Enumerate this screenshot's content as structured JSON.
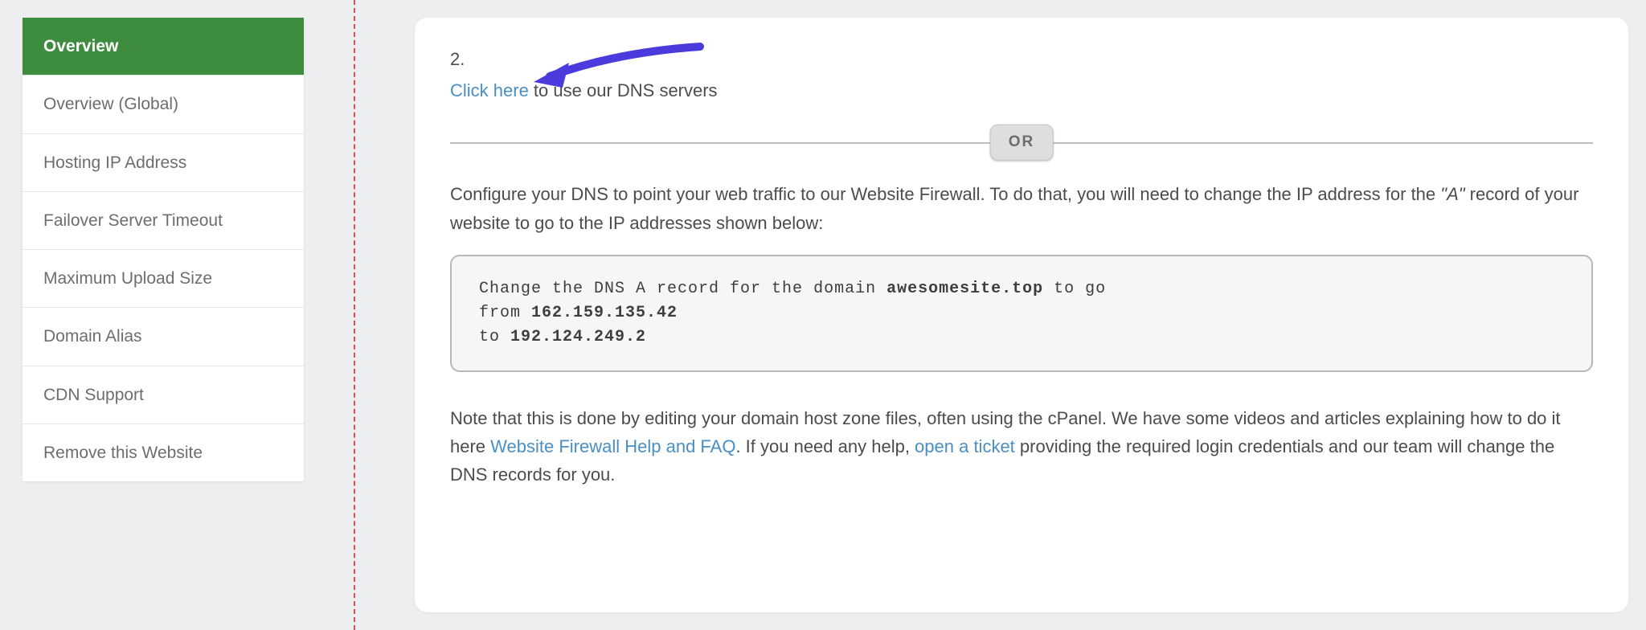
{
  "sidebar": {
    "items": [
      {
        "label": "Overview",
        "active": true
      },
      {
        "label": "Overview (Global)",
        "active": false
      },
      {
        "label": "Hosting IP Address",
        "active": false
      },
      {
        "label": "Failover Server Timeout",
        "active": false
      },
      {
        "label": "Maximum Upload Size",
        "active": false
      },
      {
        "label": "Domain Alias",
        "active": false
      },
      {
        "label": "CDN Support",
        "active": false
      },
      {
        "label": "Remove this Website",
        "active": false
      }
    ]
  },
  "main": {
    "step_number": "2.",
    "click_here_label": "Click here",
    "click_here_suffix": " to use our DNS servers",
    "or_label": "OR",
    "paragraph1_a": "Configure your DNS to point your web traffic to our Website Firewall. To do that, you will need to change the IP address for the ",
    "paragraph1_italic": "\"A\"",
    "paragraph1_b": " record of your website to go to the IP addresses shown below:",
    "code": {
      "line1_prefix": "Change the DNS A record for the domain ",
      "line1_domain": "awesomesite.top",
      "line1_suffix": " to go",
      "line2_prefix": "from ",
      "line2_ip": "162.159.135.42",
      "line3_prefix": "to ",
      "line3_ip": "192.124.249.2"
    },
    "paragraph2_a": "Note that this is done by editing your domain host zone files, often using the cPanel. We have some videos and articles explaining how to do it here ",
    "paragraph2_link1": "Website Firewall Help and FAQ",
    "paragraph2_b": ". If you need any help, ",
    "paragraph2_link2": "open a ticket",
    "paragraph2_c": " providing the required login credentials and our team will change the DNS records for you."
  }
}
